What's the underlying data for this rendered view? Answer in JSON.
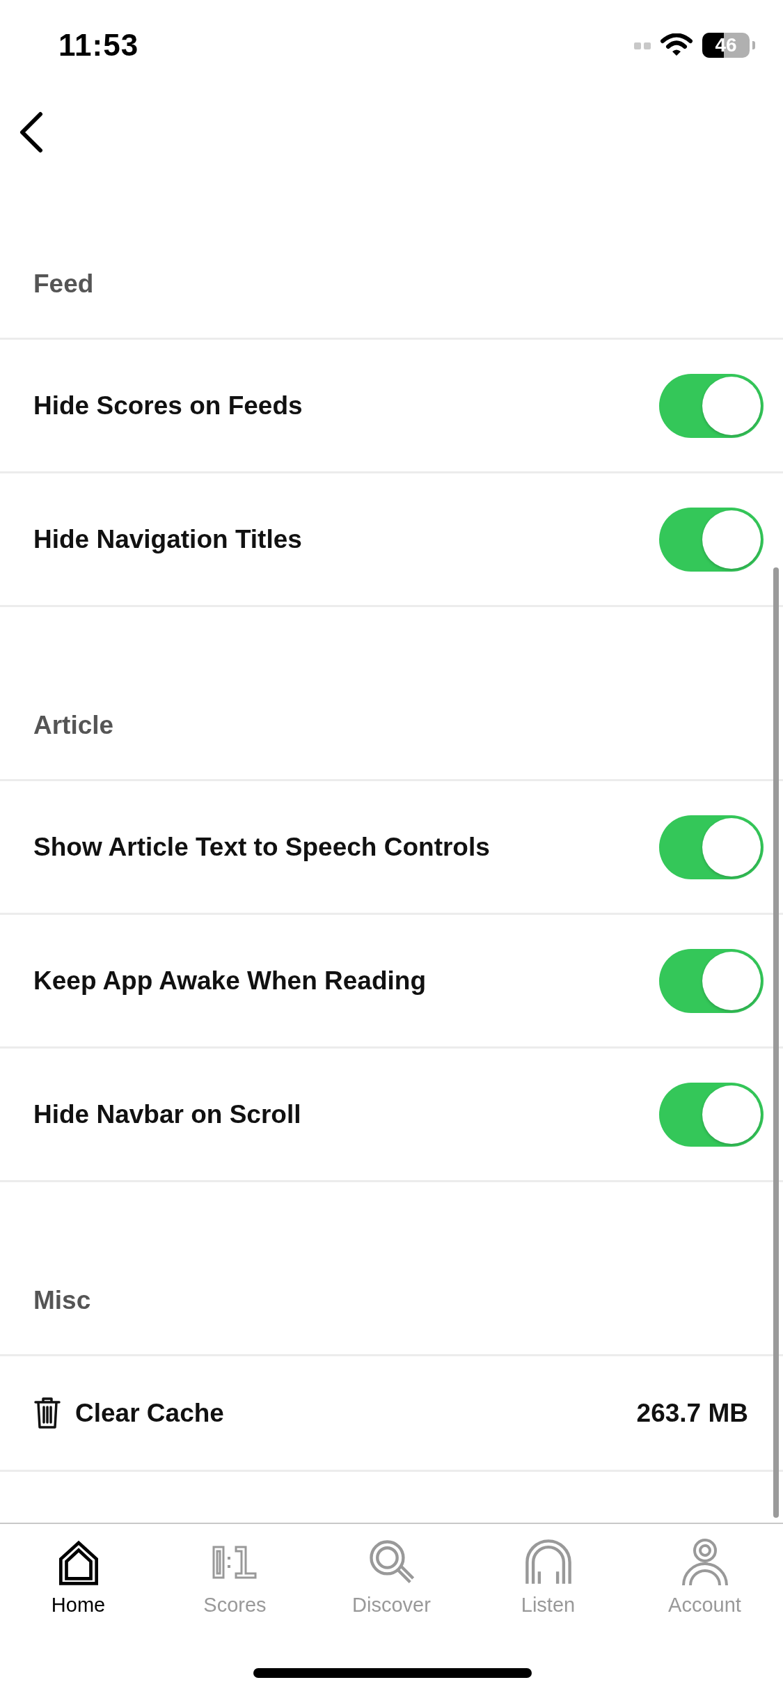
{
  "status_bar": {
    "time": "11:53",
    "battery": "46"
  },
  "sections": [
    {
      "title": "Feed",
      "rows": [
        {
          "kind": "toggle",
          "label": "Hide Scores on Feeds",
          "on": true
        },
        {
          "kind": "toggle",
          "label": "Hide Navigation Titles",
          "on": true
        }
      ]
    },
    {
      "title": "Article",
      "rows": [
        {
          "kind": "toggle",
          "label": "Show Article Text to Speech Controls",
          "on": true
        },
        {
          "kind": "toggle",
          "label": "Keep App Awake When Reading",
          "on": true
        },
        {
          "kind": "toggle",
          "label": "Hide Navbar on Scroll",
          "on": true
        }
      ]
    },
    {
      "title": "Misc",
      "rows": [
        {
          "kind": "action",
          "label": "Clear Cache",
          "value": "263.7 MB"
        }
      ]
    }
  ],
  "tabs": [
    {
      "label": "Home",
      "selected": true
    },
    {
      "label": "Scores",
      "selected": false
    },
    {
      "label": "Discover",
      "selected": false
    },
    {
      "label": "Listen",
      "selected": false
    },
    {
      "label": "Account",
      "selected": false
    }
  ]
}
